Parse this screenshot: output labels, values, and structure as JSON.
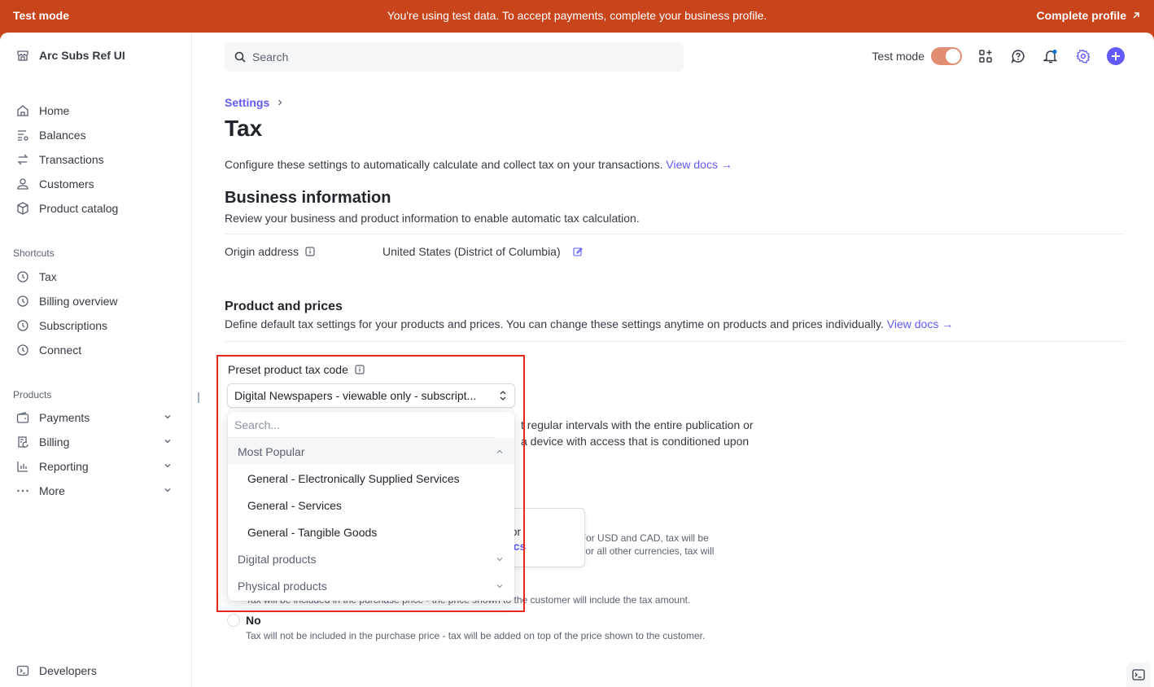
{
  "banner": {
    "mode_label": "Test mode",
    "message": "You're using test data. To accept payments, complete your business profile.",
    "cta": "Complete profile"
  },
  "sidebar": {
    "account_name": "Arc Subs Ref UI",
    "main_items": [
      {
        "label": "Home",
        "icon": "home-icon"
      },
      {
        "label": "Balances",
        "icon": "balances-icon"
      },
      {
        "label": "Transactions",
        "icon": "transactions-icon"
      },
      {
        "label": "Customers",
        "icon": "customer-icon"
      },
      {
        "label": "Product catalog",
        "icon": "box-icon"
      }
    ],
    "shortcuts_label": "Shortcuts",
    "shortcuts": [
      {
        "label": "Tax",
        "icon": "clock-icon"
      },
      {
        "label": "Billing overview",
        "icon": "clock-icon"
      },
      {
        "label": "Subscriptions",
        "icon": "clock-icon"
      },
      {
        "label": "Connect",
        "icon": "clock-icon"
      }
    ],
    "products_label": "Products",
    "products": [
      {
        "label": "Payments",
        "icon": "wallet-icon"
      },
      {
        "label": "Billing",
        "icon": "billing-icon"
      },
      {
        "label": "Reporting",
        "icon": "chart-icon"
      },
      {
        "label": "More",
        "icon": "more-icon"
      }
    ],
    "developers": "Developers"
  },
  "topbar": {
    "search_placeholder": "Search",
    "test_mode_label": "Test mode",
    "test_mode_on": true
  },
  "page": {
    "breadcrumb": "Settings",
    "title": "Tax",
    "intro": "Configure these settings to automatically calculate and collect tax on your transactions.",
    "intro_link": "View docs →",
    "business": {
      "title": "Business information",
      "subtitle": "Review your business and product information to enable automatic tax calculation.",
      "origin_label": "Origin address",
      "origin_value": "United States (District of Columbia)"
    },
    "products": {
      "title": "Product and prices",
      "subtitle": "Define default tax settings for your products and prices. You can change these settings anytime on products and prices individually.",
      "link": "View docs →",
      "tax_code_label": "Preset product tax code",
      "tax_code_value": "Digital Newspapers - viewable only - subscript...",
      "desc_line1": "t regular intervals with the entire publication or",
      "desc_line2": "a device with access that is conditioned upon",
      "popover_line1": "usive or",
      "popover_link": "ew docs",
      "inclusive_desc1": "he purchase. For USD and CAD, tax will be",
      "inclusive_desc2": "he customer. For all other currencies, tax will",
      "yes_desc": "Tax will be included in the purchase price - the price shown to the customer will include the tax amount.",
      "no_label": "No",
      "no_desc": "Tax will not be included in the purchase price - tax will be added on top of the price shown to the customer."
    }
  },
  "dropdown": {
    "search_placeholder": "Search...",
    "groups": [
      {
        "label": "Most Popular",
        "expanded": true,
        "items": [
          "General - Electronically Supplied Services",
          "General - Services",
          "General - Tangible Goods"
        ]
      },
      {
        "label": "Digital products",
        "expanded": false
      },
      {
        "label": "Physical products",
        "expanded": false
      }
    ]
  },
  "colors": {
    "banner": "#c8441a",
    "accent": "#625afa",
    "highlight": "#e5291f"
  }
}
